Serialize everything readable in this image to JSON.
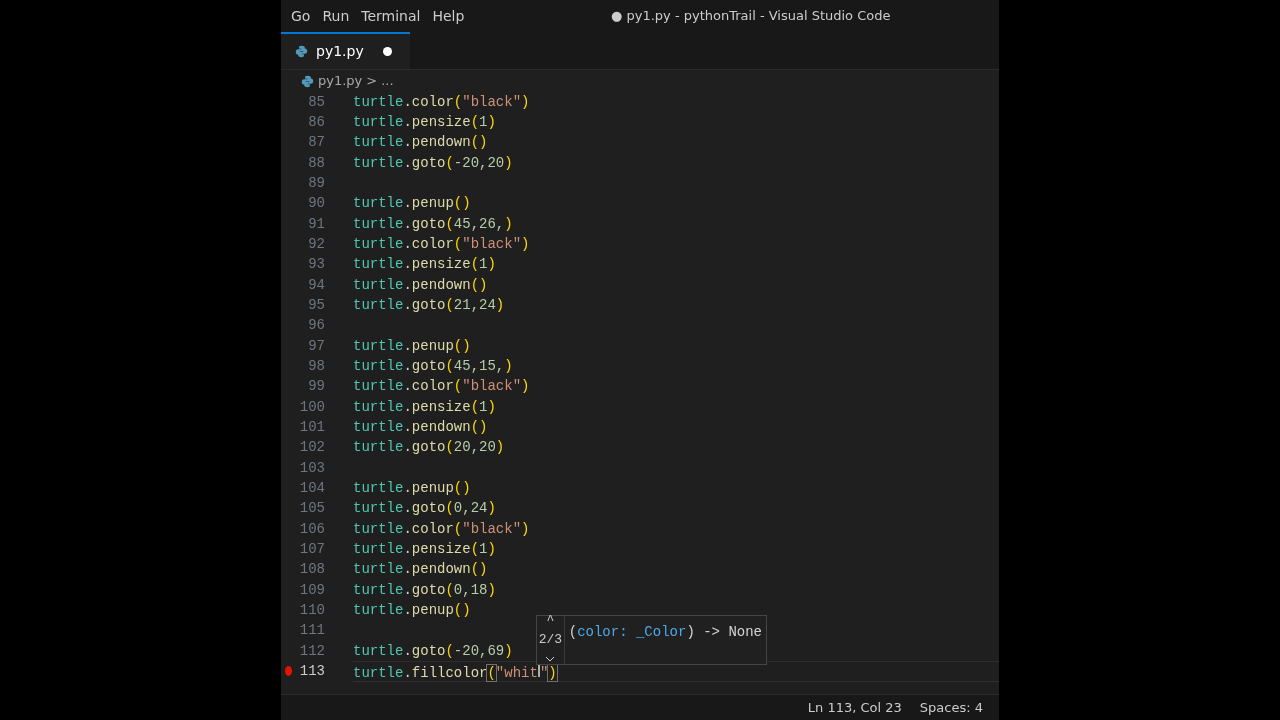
{
  "window": {
    "title": "● py1.py - pythonTrail - Visual Studio Code"
  },
  "menu": [
    {
      "label": "Go"
    },
    {
      "label": "Run"
    },
    {
      "label": "Terminal"
    },
    {
      "label": "Help"
    }
  ],
  "tabs": [
    {
      "label": "py1.py",
      "selected": true,
      "modified": true
    }
  ],
  "breadcrumb": {
    "file": "py1.py",
    "separator": ">",
    "rest": "..."
  },
  "lines": [
    {
      "number": "85",
      "tokens": [
        {
          "kind": "ident",
          "text": "turtle"
        },
        {
          "kind": "punct",
          "text": "."
        },
        {
          "kind": "method",
          "text": "color"
        },
        {
          "kind": "paren",
          "text": "("
        },
        {
          "kind": "string",
          "text": "\"black\""
        },
        {
          "kind": "paren",
          "text": ")"
        }
      ]
    },
    {
      "number": "86",
      "tokens": [
        {
          "kind": "ident",
          "text": "turtle"
        },
        {
          "kind": "punct",
          "text": "."
        },
        {
          "kind": "method",
          "text": "pensize"
        },
        {
          "kind": "paren",
          "text": "("
        },
        {
          "kind": "number",
          "text": "1"
        },
        {
          "kind": "paren",
          "text": ")"
        }
      ]
    },
    {
      "number": "87",
      "tokens": [
        {
          "kind": "ident",
          "text": "turtle"
        },
        {
          "kind": "punct",
          "text": "."
        },
        {
          "kind": "method",
          "text": "pendown"
        },
        {
          "kind": "paren",
          "text": "()"
        }
      ]
    },
    {
      "number": "88",
      "tokens": [
        {
          "kind": "ident",
          "text": "turtle"
        },
        {
          "kind": "punct",
          "text": "."
        },
        {
          "kind": "method",
          "text": "goto"
        },
        {
          "kind": "paren",
          "text": "("
        },
        {
          "kind": "number",
          "text": "-20,20"
        },
        {
          "kind": "paren",
          "text": ")"
        }
      ]
    },
    {
      "number": "89"
    },
    {
      "number": "90",
      "tokens": [
        {
          "kind": "ident",
          "text": "turtle"
        },
        {
          "kind": "punct",
          "text": "."
        },
        {
          "kind": "method",
          "text": "penup"
        },
        {
          "kind": "paren",
          "text": "()"
        }
      ]
    },
    {
      "number": "91",
      "tokens": [
        {
          "kind": "ident",
          "text": "turtle"
        },
        {
          "kind": "punct",
          "text": "."
        },
        {
          "kind": "method",
          "text": "goto"
        },
        {
          "kind": "paren",
          "text": "("
        },
        {
          "kind": "number",
          "text": "45,26,"
        },
        {
          "kind": "paren",
          "text": ")"
        }
      ]
    },
    {
      "number": "92",
      "tokens": [
        {
          "kind": "ident",
          "text": "turtle"
        },
        {
          "kind": "punct",
          "text": "."
        },
        {
          "kind": "method",
          "text": "color"
        },
        {
          "kind": "paren",
          "text": "("
        },
        {
          "kind": "string",
          "text": "\"black\""
        },
        {
          "kind": "paren",
          "text": ")"
        }
      ]
    },
    {
      "number": "93",
      "tokens": [
        {
          "kind": "ident",
          "text": "turtle"
        },
        {
          "kind": "punct",
          "text": "."
        },
        {
          "kind": "method",
          "text": "pensize"
        },
        {
          "kind": "paren",
          "text": "("
        },
        {
          "kind": "number",
          "text": "1"
        },
        {
          "kind": "paren",
          "text": ")"
        }
      ]
    },
    {
      "number": "94",
      "tokens": [
        {
          "kind": "ident",
          "text": "turtle"
        },
        {
          "kind": "punct",
          "text": "."
        },
        {
          "kind": "method",
          "text": "pendown"
        },
        {
          "kind": "paren",
          "text": "()"
        }
      ]
    },
    {
      "number": "95",
      "tokens": [
        {
          "kind": "ident",
          "text": "turtle"
        },
        {
          "kind": "punct",
          "text": "."
        },
        {
          "kind": "method",
          "text": "goto"
        },
        {
          "kind": "paren",
          "text": "("
        },
        {
          "kind": "number",
          "text": "21,24"
        },
        {
          "kind": "paren",
          "text": ")"
        }
      ]
    },
    {
      "number": "96"
    },
    {
      "number": "97",
      "tokens": [
        {
          "kind": "ident",
          "text": "turtle"
        },
        {
          "kind": "punct",
          "text": "."
        },
        {
          "kind": "method",
          "text": "penup"
        },
        {
          "kind": "paren",
          "text": "()"
        }
      ]
    },
    {
      "number": "98",
      "tokens": [
        {
          "kind": "ident",
          "text": "turtle"
        },
        {
          "kind": "punct",
          "text": "."
        },
        {
          "kind": "method",
          "text": "goto"
        },
        {
          "kind": "paren",
          "text": "("
        },
        {
          "kind": "number",
          "text": "45,15,"
        },
        {
          "kind": "paren",
          "text": ")"
        }
      ]
    },
    {
      "number": "99",
      "tokens": [
        {
          "kind": "ident",
          "text": "turtle"
        },
        {
          "kind": "punct",
          "text": "."
        },
        {
          "kind": "method",
          "text": "color"
        },
        {
          "kind": "paren",
          "text": "("
        },
        {
          "kind": "string",
          "text": "\"black\""
        },
        {
          "kind": "paren",
          "text": ")"
        }
      ]
    },
    {
      "number": "100",
      "tokens": [
        {
          "kind": "ident",
          "text": "turtle"
        },
        {
          "kind": "punct",
          "text": "."
        },
        {
          "kind": "method",
          "text": "pensize"
        },
        {
          "kind": "paren",
          "text": "("
        },
        {
          "kind": "number",
          "text": "1"
        },
        {
          "kind": "paren",
          "text": ")"
        }
      ]
    },
    {
      "number": "101",
      "tokens": [
        {
          "kind": "ident",
          "text": "turtle"
        },
        {
          "kind": "punct",
          "text": "."
        },
        {
          "kind": "method",
          "text": "pendown"
        },
        {
          "kind": "paren",
          "text": "()"
        }
      ]
    },
    {
      "number": "102",
      "tokens": [
        {
          "kind": "ident",
          "text": "turtle"
        },
        {
          "kind": "punct",
          "text": "."
        },
        {
          "kind": "method",
          "text": "goto"
        },
        {
          "kind": "paren",
          "text": "("
        },
        {
          "kind": "number",
          "text": "20,20"
        },
        {
          "kind": "paren",
          "text": ")"
        }
      ]
    },
    {
      "number": "103"
    },
    {
      "number": "104",
      "tokens": [
        {
          "kind": "ident",
          "text": "turtle"
        },
        {
          "kind": "punct",
          "text": "."
        },
        {
          "kind": "method",
          "text": "penup"
        },
        {
          "kind": "paren",
          "text": "()"
        }
      ]
    },
    {
      "number": "105",
      "tokens": [
        {
          "kind": "ident",
          "text": "turtle"
        },
        {
          "kind": "punct",
          "text": "."
        },
        {
          "kind": "method",
          "text": "goto"
        },
        {
          "kind": "paren",
          "text": "("
        },
        {
          "kind": "number",
          "text": "0,24"
        },
        {
          "kind": "paren",
          "text": ")"
        }
      ]
    },
    {
      "number": "106",
      "tokens": [
        {
          "kind": "ident",
          "text": "turtle"
        },
        {
          "kind": "punct",
          "text": "."
        },
        {
          "kind": "method",
          "text": "color"
        },
        {
          "kind": "paren",
          "text": "("
        },
        {
          "kind": "string",
          "text": "\"black\""
        },
        {
          "kind": "paren",
          "text": ")"
        }
      ]
    },
    {
      "number": "107",
      "tokens": [
        {
          "kind": "ident",
          "text": "turtle"
        },
        {
          "kind": "punct",
          "text": "."
        },
        {
          "kind": "method",
          "text": "pensize"
        },
        {
          "kind": "paren",
          "text": "("
        },
        {
          "kind": "number",
          "text": "1"
        },
        {
          "kind": "paren",
          "text": ")"
        }
      ]
    },
    {
      "number": "108",
      "tokens": [
        {
          "kind": "ident",
          "text": "turtle"
        },
        {
          "kind": "punct",
          "text": "."
        },
        {
          "kind": "method",
          "text": "pendown"
        },
        {
          "kind": "paren",
          "text": "()"
        }
      ]
    },
    {
      "number": "109",
      "tokens": [
        {
          "kind": "ident",
          "text": "turtle"
        },
        {
          "kind": "punct",
          "text": "."
        },
        {
          "kind": "method",
          "text": "goto"
        },
        {
          "kind": "paren",
          "text": "("
        },
        {
          "kind": "number",
          "text": "0,18"
        },
        {
          "kind": "paren",
          "text": ")"
        }
      ]
    },
    {
      "number": "110",
      "tokens": [
        {
          "kind": "ident",
          "text": "turtle"
        },
        {
          "kind": "punct",
          "text": "."
        },
        {
          "kind": "method",
          "text": "penup"
        },
        {
          "kind": "paren",
          "text": "()"
        }
      ]
    },
    {
      "number": "111"
    },
    {
      "number": "112",
      "tokens": [
        {
          "kind": "ident",
          "text": "turtle"
        },
        {
          "kind": "punct",
          "text": "."
        },
        {
          "kind": "method",
          "text": "goto"
        },
        {
          "kind": "paren",
          "text": "("
        },
        {
          "kind": "number",
          "text": "-20,69"
        },
        {
          "kind": "paren",
          "text": ")"
        }
      ]
    },
    {
      "number": "113",
      "current": true,
      "breakpoint": true,
      "tokens": [
        {
          "kind": "ident",
          "text": "turtle"
        },
        {
          "kind": "punct",
          "text": "."
        },
        {
          "kind": "method",
          "text": "fillcolor"
        },
        {
          "kind": "bracket",
          "text": "("
        },
        {
          "kind": "string",
          "text": "\"whit"
        },
        {
          "kind": "cursor"
        },
        {
          "kind": "string",
          "text": "\""
        },
        {
          "kind": "bracket",
          "text": ")"
        }
      ]
    }
  ],
  "parameter_hint": {
    "up": "^",
    "counter": "2/3",
    "signature": [
      {
        "kind": "punct",
        "text": "("
      },
      {
        "kind": "param",
        "text": "color: _Color"
      },
      {
        "kind": "punct",
        "text": ") -> None"
      }
    ]
  },
  "status_bar": [
    {
      "text": "Ln 113, Col 23"
    },
    {
      "text": "Spaces: 4"
    }
  ]
}
